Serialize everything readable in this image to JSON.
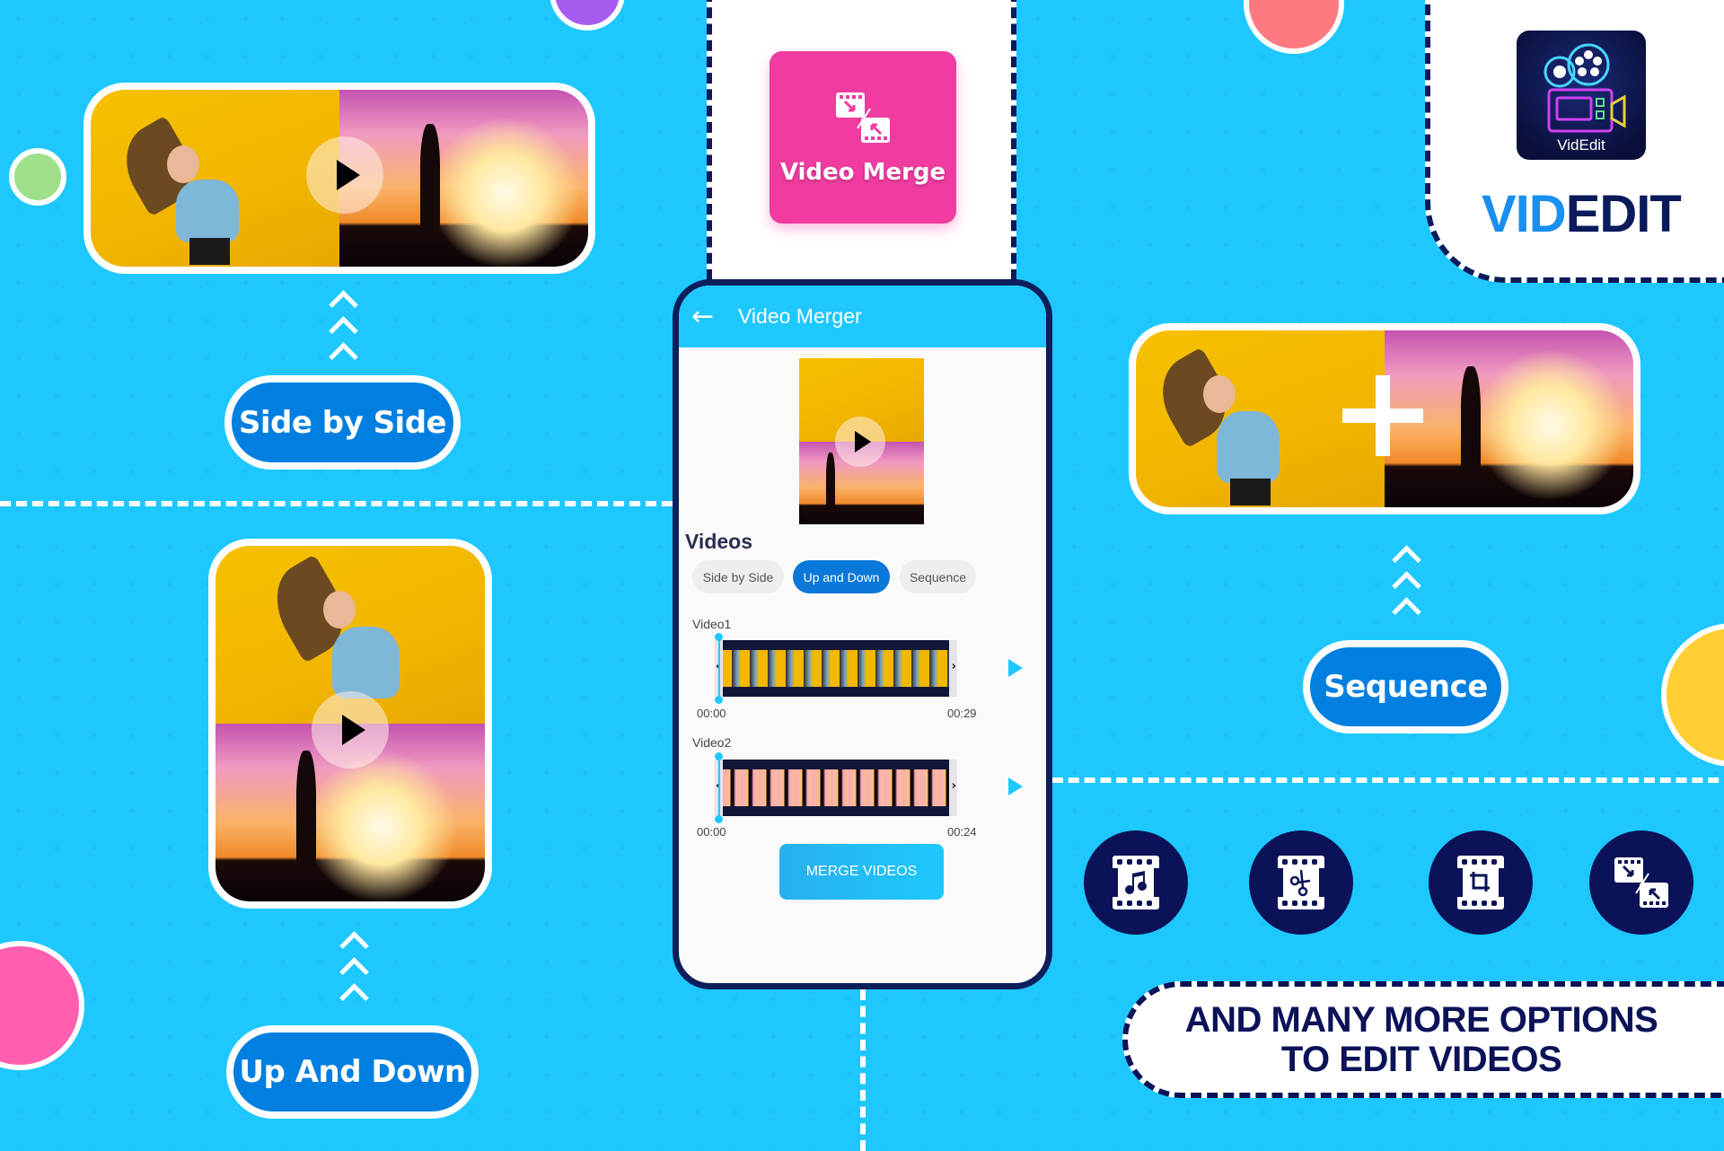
{
  "colors": {
    "background": "#1ec8fe",
    "navy": "#0b1257",
    "pill_blue": "#007fe0",
    "merge_tile_pink": "#f03ba0",
    "brand_blue": "#1a8ff0"
  },
  "demos": {
    "side_by_side": {
      "label": "Side by Side",
      "icon": "play-icon"
    },
    "up_and_down": {
      "label": "Up And Down",
      "icon": "play-icon"
    },
    "sequence": {
      "label": "Sequence",
      "icon": "plus-icon"
    }
  },
  "feature_tile": {
    "label": "Video Merge",
    "icon": "video-merge-icon"
  },
  "brand": {
    "logo_caption": "VidEdit",
    "name_part1": "VID",
    "name_part2": "EDIT"
  },
  "phone": {
    "appbar": {
      "back_icon": "arrow-left-icon",
      "title": "Video Merger"
    },
    "section_title": "Videos",
    "modes": [
      {
        "label": "Side by Side",
        "selected": false
      },
      {
        "label": "Up and Down",
        "selected": true
      },
      {
        "label": "Sequence",
        "selected": false
      }
    ],
    "videos": [
      {
        "label": "Video1",
        "start": "00:00",
        "end": "00:29"
      },
      {
        "label": "Video2",
        "start": "00:00",
        "end": "00:24"
      }
    ],
    "merge_button": "MERGE VIDEOS"
  },
  "tools": [
    {
      "icon": "film-music-icon"
    },
    {
      "icon": "film-cut-icon"
    },
    {
      "icon": "film-crop-icon"
    },
    {
      "icon": "video-merge-icon"
    }
  ],
  "tagline": {
    "line1": "AND MANY MORE OPTIONS",
    "line2": "TO EDIT VIDEOS"
  }
}
